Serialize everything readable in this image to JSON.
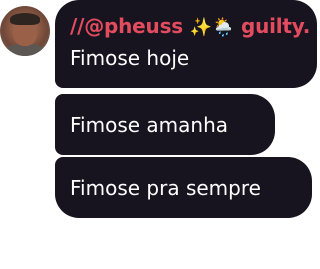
{
  "chat": {
    "author": {
      "name": "//@pheuss",
      "emoji": "✨🌦️",
      "suffix": "guilty.",
      "name_color": "#e24c5e"
    },
    "bubble_color": "#17141f",
    "messages": [
      {
        "text": "Fimose hoje"
      },
      {
        "text": "Fimose amanha"
      },
      {
        "text": "Fimose pra sempre"
      }
    ]
  }
}
